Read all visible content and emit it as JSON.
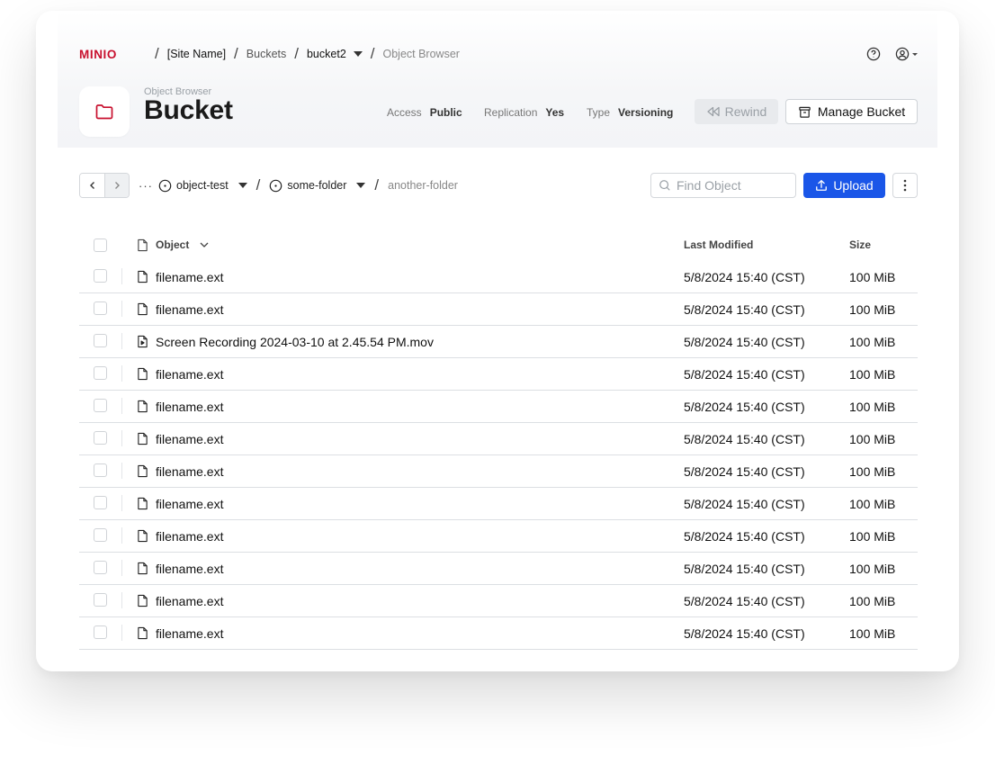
{
  "brand": "MINIO",
  "breadcrumb": {
    "site": "[Site Name]",
    "buckets": "Buckets",
    "bucket": "bucket2",
    "page": "Object Browser"
  },
  "header": {
    "subtitle": "Object Browser",
    "title": "Bucket",
    "access_label": "Access",
    "access_value": "Public",
    "replication_label": "Replication",
    "replication_value": "Yes",
    "type_label": "Type",
    "type_value": "Versioning",
    "rewind_label": "Rewind",
    "manage_label": "Manage Bucket"
  },
  "toolbar": {
    "path": [
      "object-test",
      "some-folder",
      "another-folder"
    ],
    "search_placeholder": "Find Object",
    "upload_label": "Upload"
  },
  "table": {
    "columns": [
      "Object",
      "Last Modified",
      "Size"
    ],
    "rows": [
      {
        "name": "filename.ext",
        "modified": "5/8/2024 15:40 (CST)",
        "size": "100 MiB",
        "icon": "file-icon"
      },
      {
        "name": "filename.ext",
        "modified": "5/8/2024 15:40 (CST)",
        "size": "100 MiB",
        "icon": "file-icon"
      },
      {
        "name": "Screen Recording 2024-03-10 at 2.45.54 PM.mov",
        "modified": "5/8/2024 15:40 (CST)",
        "size": "100 MiB",
        "icon": "video-file-icon"
      },
      {
        "name": "filename.ext",
        "modified": "5/8/2024 15:40 (CST)",
        "size": "100 MiB",
        "icon": "file-icon"
      },
      {
        "name": "filename.ext",
        "modified": "5/8/2024 15:40 (CST)",
        "size": "100 MiB",
        "icon": "file-icon"
      },
      {
        "name": "filename.ext",
        "modified": "5/8/2024 15:40 (CST)",
        "size": "100 MiB",
        "icon": "file-icon"
      },
      {
        "name": "filename.ext",
        "modified": "5/8/2024 15:40 (CST)",
        "size": "100 MiB",
        "icon": "file-icon"
      },
      {
        "name": "filename.ext",
        "modified": "5/8/2024 15:40 (CST)",
        "size": "100 MiB",
        "icon": "file-icon"
      },
      {
        "name": "filename.ext",
        "modified": "5/8/2024 15:40 (CST)",
        "size": "100 MiB",
        "icon": "file-icon"
      },
      {
        "name": "filename.ext",
        "modified": "5/8/2024 15:40 (CST)",
        "size": "100 MiB",
        "icon": "file-icon"
      },
      {
        "name": "filename.ext",
        "modified": "5/8/2024 15:40 (CST)",
        "size": "100 MiB",
        "icon": "file-icon"
      },
      {
        "name": "filename.ext",
        "modified": "5/8/2024 15:40 (CST)",
        "size": "100 MiB",
        "icon": "file-icon"
      }
    ]
  },
  "colors": {
    "brand_red": "#c8102e",
    "primary_blue": "#1a56e8",
    "disabled_bg": "#e8eaed",
    "row_border": "#dcdfe3"
  }
}
